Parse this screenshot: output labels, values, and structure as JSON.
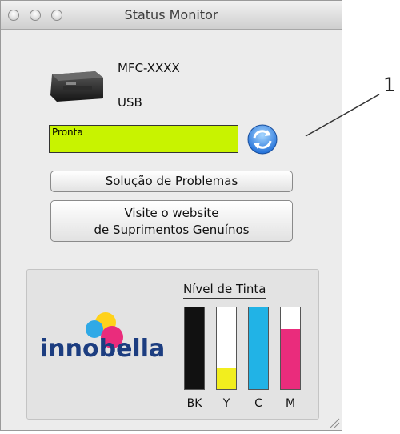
{
  "window": {
    "title": "Status Monitor"
  },
  "device": {
    "name": "MFC-XXXX",
    "connection": "USB"
  },
  "status": {
    "text": "Pronta",
    "color": "#c8f300"
  },
  "buttons": {
    "troubleshoot": "Solução de Problemas",
    "website_line1": "Visite o website",
    "website_line2": "de Suprimentos Genuínos"
  },
  "ink": {
    "title": "Nível de Tinta",
    "brand": "innobella",
    "levels": [
      {
        "label": "BK",
        "color": "#111111",
        "fraction": 1.0
      },
      {
        "label": "Y",
        "color": "#f2ee1e",
        "fraction": 0.26
      },
      {
        "label": "C",
        "color": "#21b3e6",
        "fraction": 1.0
      },
      {
        "label": "M",
        "color": "#ea2c7c",
        "fraction": 0.74
      }
    ]
  },
  "callout": {
    "number": "1"
  },
  "icons": {
    "refresh": "refresh-icon",
    "printer": "printer-icon",
    "resize": "resize-grip-icon"
  }
}
